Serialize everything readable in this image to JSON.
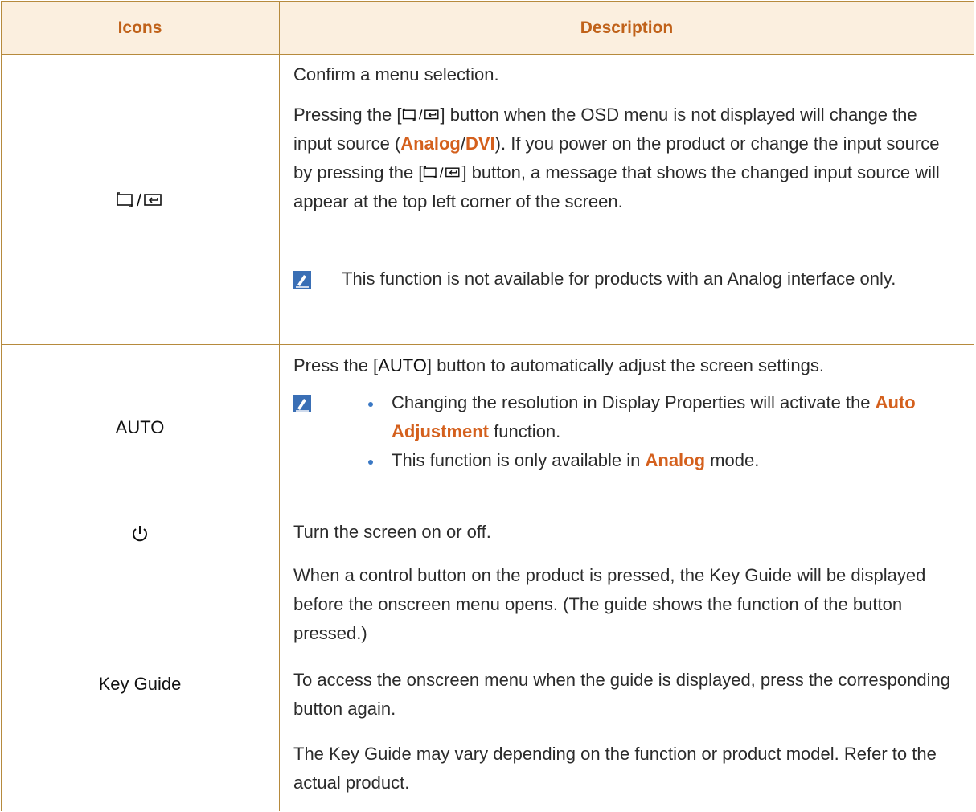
{
  "header": {
    "icons": "Icons",
    "description": "Description"
  },
  "rows": {
    "source": {
      "icon": "source-enter-icon",
      "p1": "Confirm a menu selection.",
      "p2_pre": "Pressing the [",
      "p2_mid1": "] button when the OSD menu is not displayed will change the input source (",
      "hl_analog": "Analog",
      "slash": "/",
      "hl_dvi": "DVI",
      "p2_mid2": "). If you power on the product or change the input source by pressing the [",
      "p2_post": "] button, a message that shows the changed input source will appear at the top left corner of the screen.",
      "note": "This function is not available for products with an Analog interface only."
    },
    "auto": {
      "label": "AUTO",
      "p1_pre": "Press the [",
      "p1_key": "AUTO",
      "p1_post": "] button to automatically adjust the screen settings.",
      "b1_pre": "Changing the resolution in Display Properties will activate the ",
      "b1_hl": "Auto Adjustment",
      "b1_post": " function.",
      "b2_pre": "This function is only available in ",
      "b2_hl": "Analog",
      "b2_post": " mode."
    },
    "power": {
      "icon": "power-icon",
      "p1": "Turn the screen on or off."
    },
    "keyguide": {
      "label": "Key Guide",
      "p1": "When a control button on the product is pressed, the Key Guide will be displayed before the onscreen menu opens. (The guide shows the function of the button pressed.)",
      "p2": "To access the onscreen menu when the guide is displayed, press the corresponding button again.",
      "p3": "The Key Guide may vary depending on the function or product model. Refer to the actual product."
    }
  },
  "colors": {
    "accent": "#d4601d",
    "border": "#b68a3d",
    "header_bg": "#fbefdf",
    "bullet": "#3a78c4"
  }
}
